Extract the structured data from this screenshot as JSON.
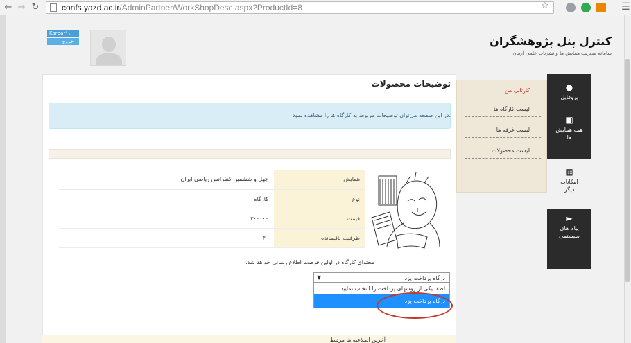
{
  "browser": {
    "url_host": "confs.yazd.ac.ir",
    "url_path": "/AdminPartner/WorkShopDesc.aspx?ProductId=8"
  },
  "header": {
    "title": "کنترل پنل پژوهشگران",
    "subtitle": "سامانه مدیریت همایش ها و نشریات علمی آرمان",
    "user_label": "Karbar۱۱",
    "logout_label": "خروج"
  },
  "main": {
    "section_title": "توضیحات محصولات",
    "info_text": ".در این صفحه می‌توان توضیحات مربوط به کارگاه ها را مشاهده نمود",
    "table": [
      {
        "label": "همایش",
        "value": "چهل و ششمین کنفرانس ریاضی ایران"
      },
      {
        "label": "نوع",
        "value": "کارگاه"
      },
      {
        "label": "قیمت",
        "value": "۳۰۰۰۰۰"
      },
      {
        "label": "ظرفیت باقیمانده",
        "value": "۳۰"
      }
    ],
    "notice": "محتوای کارگاه در اولین فرصت اطلاع رسانی خواهد شد.",
    "select": {
      "value": "درگاه پرداخت یزد",
      "options": [
        "لطفا یکی از روشهای پرداخت را انتخاب نمایید",
        "درگاه پرداخت یزد"
      ]
    },
    "footer_heading": "آخرین اطلاعیه ها مرتبط"
  },
  "tabs": [
    "کارتابل من",
    "لیست کارگاه ها",
    "لیست غرفه ها",
    "لیست محصولات"
  ],
  "sidenav": [
    {
      "label": "پروفایل",
      "icon": "user-icon"
    },
    {
      "label": "همه همایش ها",
      "icon": "briefcase-icon"
    },
    {
      "label": "امکانات دیگر",
      "icon": "grid-icon"
    },
    {
      "label": "پیام های سیستمی",
      "icon": "megaphone-icon"
    }
  ],
  "colors": {
    "accent": "#4a9fd8",
    "sidenav_bg": "#2b2b2b",
    "active_tab": "#c0392b",
    "selected_option": "#1e90ff",
    "highlight": "#c0392b"
  }
}
